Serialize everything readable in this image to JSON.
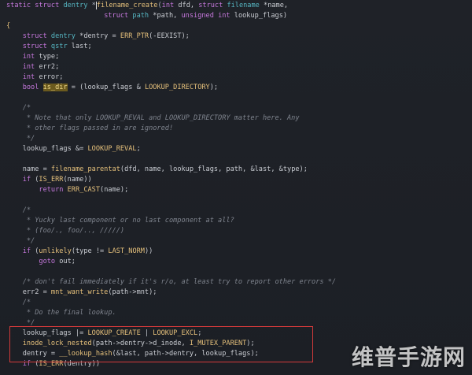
{
  "code_lines": [
    [
      {
        "t": "static ",
        "c": "kw"
      },
      {
        "t": "struct ",
        "c": "kw"
      },
      {
        "t": "dentry ",
        "c": "ty"
      },
      {
        "t": "*",
        "c": "op"
      },
      {
        "t": "",
        "c": "cursor"
      },
      {
        "t": "filename_create",
        "c": "fn"
      },
      {
        "t": "(",
        "c": "op"
      },
      {
        "t": "int ",
        "c": "kw"
      },
      {
        "t": "dfd, ",
        "c": "pl"
      },
      {
        "t": "struct ",
        "c": "kw"
      },
      {
        "t": "filename ",
        "c": "ty"
      },
      {
        "t": "*name,",
        "c": "pl"
      }
    ],
    [
      {
        "t": "                        ",
        "c": "pl"
      },
      {
        "t": "struct ",
        "c": "kw"
      },
      {
        "t": "path ",
        "c": "ty"
      },
      {
        "t": "*path, ",
        "c": "pl"
      },
      {
        "t": "unsigned ",
        "c": "kw"
      },
      {
        "t": "int ",
        "c": "kw"
      },
      {
        "t": "lookup_flags)",
        "c": "pl"
      }
    ],
    [
      {
        "t": "{",
        "c": "fn"
      }
    ],
    [
      {
        "t": "    ",
        "c": "pl"
      },
      {
        "t": "struct ",
        "c": "kw"
      },
      {
        "t": "dentry ",
        "c": "ty"
      },
      {
        "t": "*dentry = ",
        "c": "pl"
      },
      {
        "t": "ERR_PTR",
        "c": "fn"
      },
      {
        "t": "(-EEXIST);",
        "c": "pl"
      }
    ],
    [
      {
        "t": "    ",
        "c": "pl"
      },
      {
        "t": "struct ",
        "c": "kw"
      },
      {
        "t": "qstr ",
        "c": "ty"
      },
      {
        "t": "last;",
        "c": "pl"
      }
    ],
    [
      {
        "t": "    ",
        "c": "pl"
      },
      {
        "t": "int ",
        "c": "kw"
      },
      {
        "t": "type;",
        "c": "pl"
      }
    ],
    [
      {
        "t": "    ",
        "c": "pl"
      },
      {
        "t": "int ",
        "c": "kw"
      },
      {
        "t": "err2;",
        "c": "pl"
      }
    ],
    [
      {
        "t": "    ",
        "c": "pl"
      },
      {
        "t": "int ",
        "c": "kw"
      },
      {
        "t": "error;",
        "c": "pl"
      }
    ],
    [
      {
        "t": "    ",
        "c": "pl"
      },
      {
        "t": "bool ",
        "c": "kw"
      },
      {
        "t": "is_dir",
        "c": "hl-var"
      },
      {
        "t": " = (lookup_flags & ",
        "c": "pl"
      },
      {
        "t": "LOOKUP_DIRECTORY",
        "c": "mac"
      },
      {
        "t": ");",
        "c": "pl"
      }
    ],
    [
      {
        "t": "",
        "c": "pl"
      }
    ],
    [
      {
        "t": "    /*",
        "c": "cm"
      }
    ],
    [
      {
        "t": "     * Note that only LOOKUP_REVAL and LOOKUP_DIRECTORY matter here. Any",
        "c": "cm"
      }
    ],
    [
      {
        "t": "     * other flags passed in are ignored!",
        "c": "cm"
      }
    ],
    [
      {
        "t": "     */",
        "c": "cm"
      }
    ],
    [
      {
        "t": "    lookup_flags &= ",
        "c": "pl"
      },
      {
        "t": "LOOKUP_REVAL",
        "c": "mac"
      },
      {
        "t": ";",
        "c": "pl"
      }
    ],
    [
      {
        "t": "",
        "c": "pl"
      }
    ],
    [
      {
        "t": "    name = ",
        "c": "pl"
      },
      {
        "t": "filename_parentat",
        "c": "fn"
      },
      {
        "t": "(dfd, name, lookup_flags, path, &last, &type);",
        "c": "pl"
      }
    ],
    [
      {
        "t": "    ",
        "c": "pl"
      },
      {
        "t": "if ",
        "c": "kw"
      },
      {
        "t": "(",
        "c": "pl"
      },
      {
        "t": "IS_ERR",
        "c": "fn"
      },
      {
        "t": "(name))",
        "c": "pl"
      }
    ],
    [
      {
        "t": "        ",
        "c": "pl"
      },
      {
        "t": "return ",
        "c": "kw"
      },
      {
        "t": "ERR_CAST",
        "c": "fn"
      },
      {
        "t": "(name);",
        "c": "pl"
      }
    ],
    [
      {
        "t": "",
        "c": "pl"
      }
    ],
    [
      {
        "t": "    /*",
        "c": "cm"
      }
    ],
    [
      {
        "t": "     * Yucky last component or no last component at all?",
        "c": "cm"
      }
    ],
    [
      {
        "t": "     * (foo/., foo/.., /////)",
        "c": "cm"
      }
    ],
    [
      {
        "t": "     */",
        "c": "cm"
      }
    ],
    [
      {
        "t": "    ",
        "c": "pl"
      },
      {
        "t": "if ",
        "c": "kw"
      },
      {
        "t": "(",
        "c": "pl"
      },
      {
        "t": "unlikely",
        "c": "fn"
      },
      {
        "t": "(type != ",
        "c": "pl"
      },
      {
        "t": "LAST_NORM",
        "c": "mac"
      },
      {
        "t": "))",
        "c": "pl"
      }
    ],
    [
      {
        "t": "        ",
        "c": "pl"
      },
      {
        "t": "goto ",
        "c": "kw"
      },
      {
        "t": "out;",
        "c": "pl"
      }
    ],
    [
      {
        "t": "",
        "c": "pl"
      }
    ],
    [
      {
        "t": "    /* don't fail immediately if it's r/o, at least try to report other errors */",
        "c": "cm"
      }
    ],
    [
      {
        "t": "    err2 = ",
        "c": "pl"
      },
      {
        "t": "mnt_want_write",
        "c": "fn"
      },
      {
        "t": "(path->mnt);",
        "c": "pl"
      }
    ],
    [
      {
        "t": "    /*",
        "c": "cm"
      }
    ],
    [
      {
        "t": "     * Do the final lookup.",
        "c": "cm"
      }
    ],
    [
      {
        "t": "     */",
        "c": "cm"
      }
    ],
    [
      {
        "t": "    lookup_flags |= ",
        "c": "pl"
      },
      {
        "t": "LOOKUP_CREATE",
        "c": "mac"
      },
      {
        "t": " | ",
        "c": "pl"
      },
      {
        "t": "LOOKUP_EXCL",
        "c": "mac"
      },
      {
        "t": ";",
        "c": "pl"
      }
    ],
    [
      {
        "t": "    ",
        "c": "pl"
      },
      {
        "t": "inode_lock_nested",
        "c": "fn"
      },
      {
        "t": "(path->dentry->d_inode, ",
        "c": "pl"
      },
      {
        "t": "I_MUTEX_PARENT",
        "c": "mac"
      },
      {
        "t": ");",
        "c": "pl"
      }
    ],
    [
      {
        "t": "    dentry = ",
        "c": "pl"
      },
      {
        "t": "__lookup_hash",
        "c": "fn"
      },
      {
        "t": "(&last, path->dentry, lookup_flags);",
        "c": "pl"
      }
    ],
    [
      {
        "t": "    ",
        "c": "pl"
      },
      {
        "t": "if ",
        "c": "kw"
      },
      {
        "t": "(",
        "c": "pl"
      },
      {
        "t": "IS_ERR",
        "c": "fn"
      },
      {
        "t": "(dentry))",
        "c": "pl"
      }
    ]
  ],
  "watermark": {
    "text": "维普手游网"
  }
}
